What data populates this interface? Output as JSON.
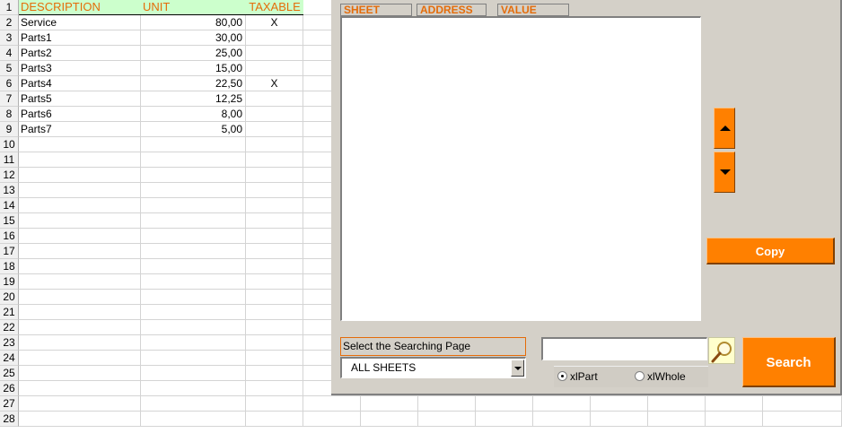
{
  "sheet": {
    "headers": {
      "description": "DESCRIPTION",
      "unit": "UNIT",
      "taxable": "TAXABLE"
    },
    "row_numbers": [
      "1",
      "2",
      "3",
      "4",
      "5",
      "6",
      "7",
      "8",
      "9",
      "10",
      "11",
      "12",
      "13",
      "14",
      "15",
      "16",
      "17",
      "18",
      "19",
      "20",
      "21",
      "22",
      "23",
      "24",
      "25",
      "26",
      "27",
      "28"
    ],
    "rows": [
      {
        "description": "Service",
        "unit": "80,00",
        "taxable": "X"
      },
      {
        "description": "Parts1",
        "unit": "30,00",
        "taxable": ""
      },
      {
        "description": "Parts2",
        "unit": "25,00",
        "taxable": ""
      },
      {
        "description": "Parts3",
        "unit": "15,00",
        "taxable": ""
      },
      {
        "description": "Parts4",
        "unit": "22,50",
        "taxable": "X"
      },
      {
        "description": "Parts5",
        "unit": "12,25",
        "taxable": ""
      },
      {
        "description": "Parts6",
        "unit": "8,00",
        "taxable": ""
      },
      {
        "description": "Parts7",
        "unit": "5,00",
        "taxable": ""
      }
    ]
  },
  "form": {
    "columns": {
      "sheet": "SHEET",
      "address": "ADDRESS",
      "value": "VALUE"
    },
    "copy_label": "Copy",
    "select_label": "Select the Searching Page",
    "combo_value": "ALL SHEETS",
    "search_value": "",
    "option_part": "xlPart",
    "option_whole": "xlWhole",
    "search_label": "Search"
  },
  "colors": {
    "accent": "#ff8000",
    "header_text": "#e46c0a",
    "header_fill": "#ccffcc",
    "form_bg": "#d4d0c8"
  },
  "icons": [
    "arrow-up-icon",
    "arrow-down-icon",
    "magnifier-icon",
    "dropdown-arrow-icon"
  ]
}
